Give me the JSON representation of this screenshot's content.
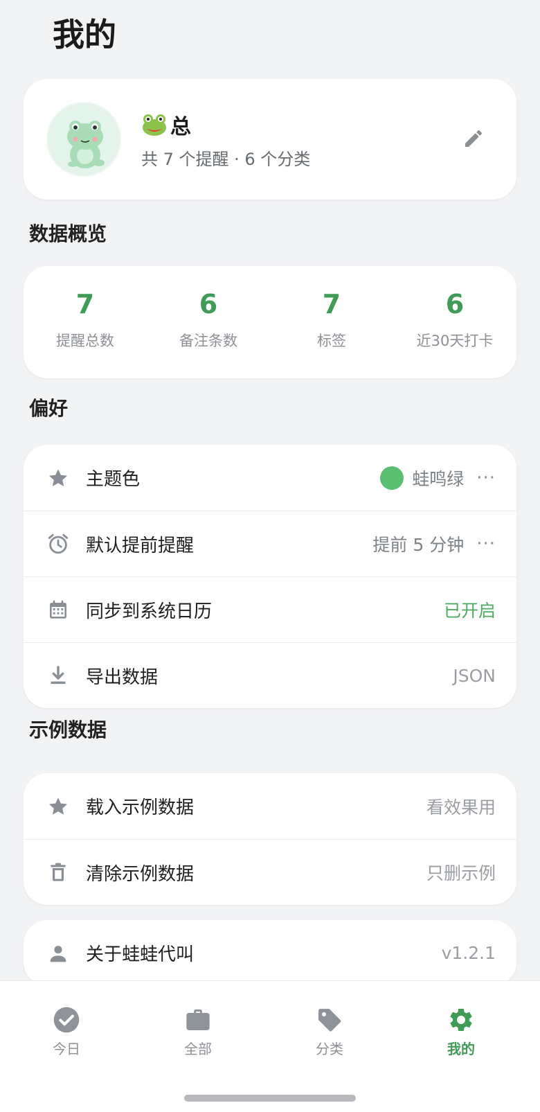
{
  "page": {
    "title": "我的"
  },
  "profile": {
    "name": "总",
    "summary": "共 7 个提醒 · 6 个分类"
  },
  "overview": {
    "section_title": "数据概览",
    "stats": [
      {
        "value": "7",
        "label": "提醒总数"
      },
      {
        "value": "6",
        "label": "备注条数"
      },
      {
        "value": "7",
        "label": "标签"
      },
      {
        "value": "6",
        "label": "近30天打卡"
      }
    ]
  },
  "preferences": {
    "section_title": "偏好",
    "items": [
      {
        "label": "主题色",
        "value": "蛙鸣绿",
        "icon": "star-icon",
        "swatch_color": "#5bbf72"
      },
      {
        "label": "默认提前提醒",
        "value": "提前 5 分钟",
        "icon": "alarm-clock-icon"
      },
      {
        "label": "同步到系统日历",
        "value": "已开启",
        "icon": "calendar-icon"
      },
      {
        "label": "导出数据",
        "value": "JSON",
        "icon": "download-icon"
      }
    ],
    "more_glyph": "···"
  },
  "demo": {
    "section_title": "示例数据",
    "items": [
      {
        "label": "载入示例数据",
        "value": "看效果用",
        "icon": "star-icon"
      },
      {
        "label": "清除示例数据",
        "value": "只删示例",
        "icon": "trash-icon"
      }
    ]
  },
  "about": {
    "label": "关于蛙蛙代叫",
    "value": "v1.2.1",
    "icon": "person-icon"
  },
  "tabbar": {
    "tabs": [
      {
        "label": "今日",
        "icon": "check-circle-icon",
        "active": false
      },
      {
        "label": "全部",
        "icon": "briefcase-icon",
        "active": false
      },
      {
        "label": "分类",
        "icon": "tag-icon",
        "active": false
      },
      {
        "label": "我的",
        "icon": "gear-icon",
        "active": true
      }
    ]
  },
  "colors": {
    "accent": "#3f9b55",
    "background": "#f2f3f5",
    "card": "#ffffff",
    "muted": "#8d9196"
  }
}
